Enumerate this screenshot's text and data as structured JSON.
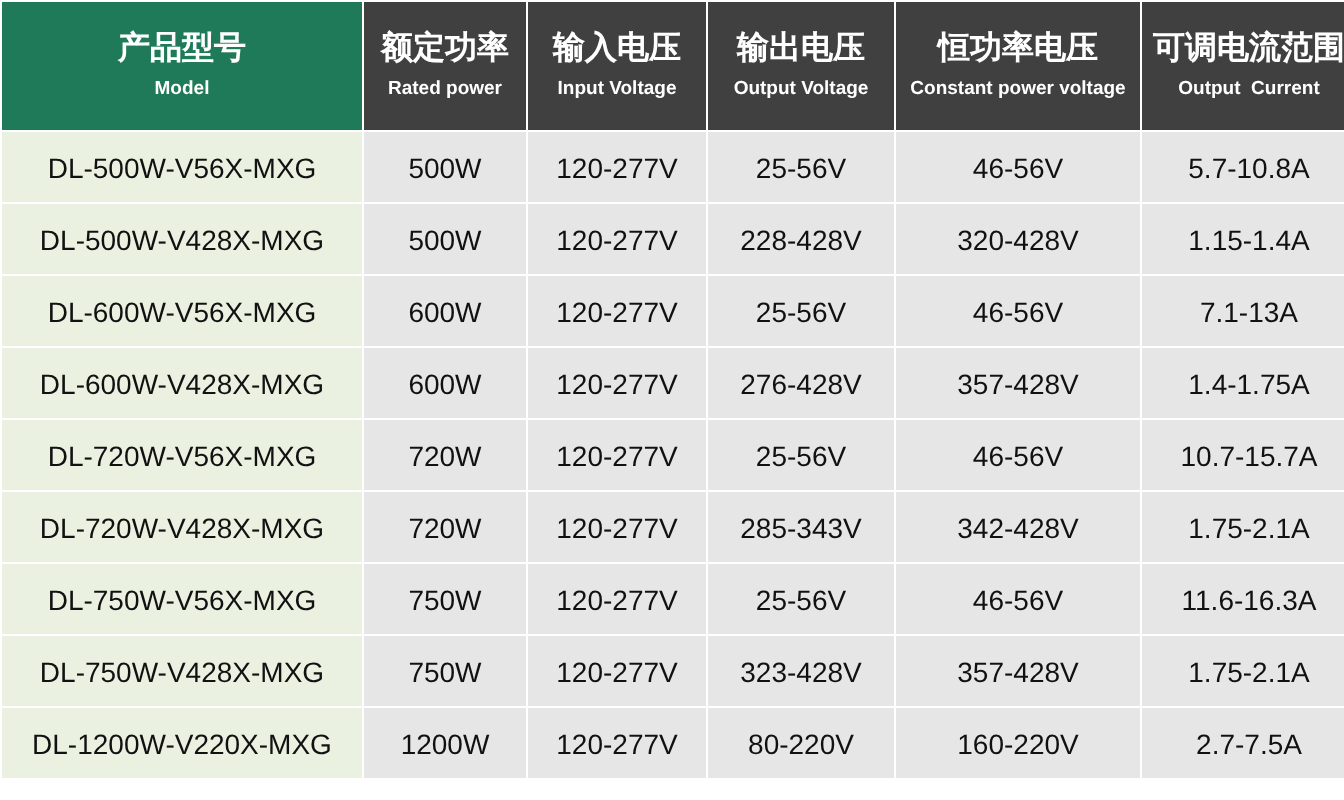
{
  "table": {
    "columns": [
      {
        "label": "产品型号",
        "sublabel": "Model",
        "kind": "model"
      },
      {
        "label": "额定功率",
        "sublabel": "Rated power",
        "kind": "spec"
      },
      {
        "label": "输入电压",
        "sublabel": "Input Voltage",
        "kind": "spec"
      },
      {
        "label": "输出电压",
        "sublabel": "Output Voltage",
        "kind": "spec"
      },
      {
        "label": "恒功率电压",
        "sublabel": "Constant power voltage",
        "kind": "spec"
      },
      {
        "label": "可调电流范围",
        "sublabel": "Output  Current",
        "kind": "spec"
      }
    ],
    "rows": [
      [
        "DL-500W-V56X-MXG",
        "500W",
        "120-277V",
        "25-56V",
        "46-56V",
        "5.7-10.8A"
      ],
      [
        "DL-500W-V428X-MXG",
        "500W",
        "120-277V",
        "228-428V",
        "320-428V",
        "1.15-1.4A"
      ],
      [
        "DL-600W-V56X-MXG",
        "600W",
        "120-277V",
        "25-56V",
        "46-56V",
        "7.1-13A"
      ],
      [
        "DL-600W-V428X-MXG",
        "600W",
        "120-277V",
        "276-428V",
        "357-428V",
        "1.4-1.75A"
      ],
      [
        "DL-720W-V56X-MXG",
        "720W",
        "120-277V",
        "25-56V",
        "46-56V",
        "10.7-15.7A"
      ],
      [
        "DL-720W-V428X-MXG",
        "720W",
        "120-277V",
        "285-343V",
        "342-428V",
        "1.75-2.1A"
      ],
      [
        "DL-750W-V56X-MXG",
        "750W",
        "120-277V",
        "25-56V",
        "46-56V",
        "11.6-16.3A"
      ],
      [
        "DL-750W-V428X-MXG",
        "750W",
        "120-277V",
        "323-428V",
        "357-428V",
        "1.75-2.1A"
      ],
      [
        "DL-1200W-V220X-MXG",
        "1200W",
        "120-277V",
        "80-220V",
        "160-220V",
        "2.7-7.5A"
      ]
    ]
  }
}
